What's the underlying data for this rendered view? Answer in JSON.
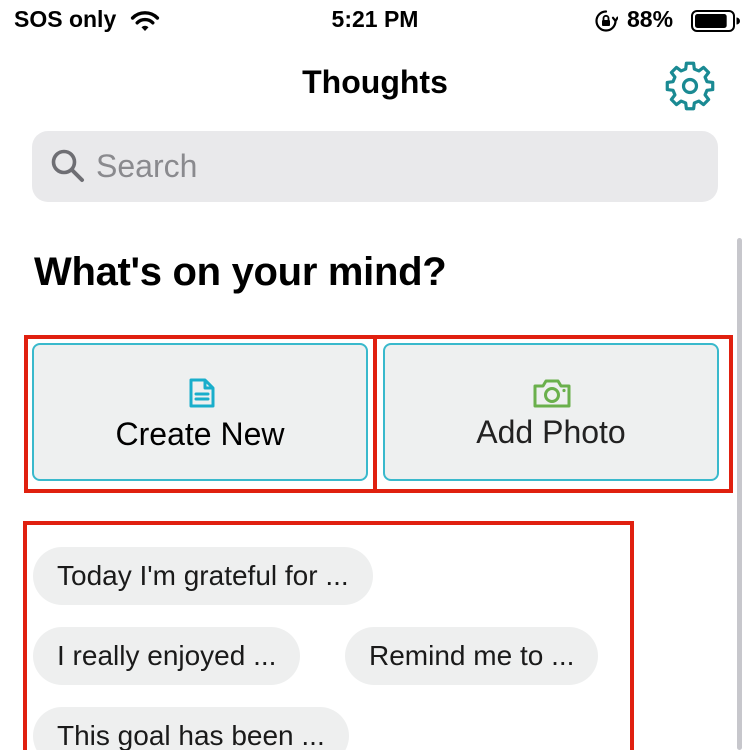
{
  "status_bar": {
    "carrier": "SOS only",
    "time": "5:21 PM",
    "battery_percent": "88%",
    "battery_level": 0.88
  },
  "nav": {
    "title": "Thoughts",
    "settings_icon": "gear-icon"
  },
  "search": {
    "placeholder": "Search",
    "icon": "search-icon"
  },
  "main": {
    "heading": "What's on your mind?",
    "actions": [
      {
        "label": "Create New",
        "icon": "document-icon",
        "color": "#19aecb"
      },
      {
        "label": "Add Photo",
        "icon": "camera-icon",
        "color": "#6ab04c"
      }
    ],
    "prompts": [
      {
        "label": "Today I'm grateful for ..."
      },
      {
        "label": "I really enjoyed ..."
      },
      {
        "label": "Remind me to ..."
      },
      {
        "label": "This goal has been ..."
      }
    ]
  },
  "colors": {
    "accent": "#1a8a93",
    "card_border": "#39b9cc",
    "highlight": "#e0200f",
    "chip_background": "#eeefef"
  }
}
